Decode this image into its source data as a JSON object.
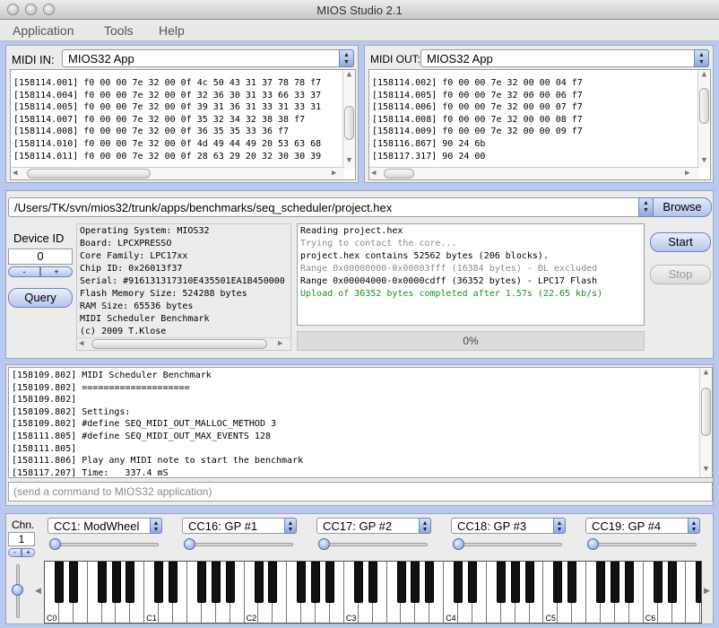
{
  "window": {
    "title": "MIOS Studio 2.1"
  },
  "menu": [
    "Application",
    "Tools",
    "Help"
  ],
  "midi_in": {
    "label": "MIDI IN:",
    "selected": "MIOS32 App",
    "lines": [
      "[158114.001] f0 00 00 7e 32 00 0f 4c 50 43 31 37 78 78 f7",
      "[158114.004] f0 00 00 7e 32 00 0f 32 36 30 31 33 66 33 37",
      "[158114.005] f0 00 00 7e 32 00 0f 39 31 36 31 33 31 33 31",
      "[158114.007] f0 00 00 7e 32 00 0f 35 32 34 32 38 38 f7",
      "[158114.008] f0 00 00 7e 32 00 0f 36 35 35 33 36 f7",
      "[158114.010] f0 00 00 7e 32 00 0f 4d 49 44 49 20 53 63 68",
      "[158114.011] f0 00 00 7e 32 00 0f 28 63 29 20 32 30 30 39"
    ]
  },
  "midi_out": {
    "label": "MIDI OUT:",
    "selected": "MIOS32 App",
    "lines": [
      "[158114.002] f0 00 00 7e 32 00 00 04 f7",
      "[158114.005] f0 00 00 7e 32 00 00 06 f7",
      "[158114.006] f0 00 00 7e 32 00 00 07 f7",
      "[158114.008] f0 00 00 7e 32 00 00 08 f7",
      "[158114.009] f0 00 00 7e 32 00 00 09 f7",
      "[158116.867] 90 24 6b",
      "[158117.317] 90 24 00"
    ]
  },
  "upload": {
    "file_path": "/Users/TK/svn/mios32/trunk/apps/benchmarks/seq_scheduler/project.hex",
    "browse_label": "Browse",
    "device_id_label": "Device ID",
    "device_id_value": "0",
    "dec_label": "-",
    "inc_label": "+",
    "query_label": "Query",
    "start_label": "Start",
    "stop_label": "Stop",
    "progress_text": "0%",
    "progress": 0,
    "info_lines": [
      "Operating System: MIOS32",
      "Board: LPCXPRESSO",
      "Core Family: LPC17xx",
      "Chip ID: 0x26013f37",
      "Serial: #916131317310E435501EA1B450000",
      "Flash Memory Size: 524288 bytes",
      "RAM Size: 65536 bytes",
      "MIDI Scheduler Benchmark",
      "(c) 2009 T.Klose"
    ],
    "status_lines": [
      {
        "text": "Reading project.hex",
        "color": "#000000"
      },
      {
        "text": "Trying to contact the core...",
        "color": "#8a8a8a"
      },
      {
        "text": "project.hex contains 52562 bytes (206 blocks).",
        "color": "#000000"
      },
      {
        "text": "Range 0x00000000-0x00003fff (16384 bytes) - BL excluded",
        "color": "#8a8a8a"
      },
      {
        "text": "Range 0x00004000-0x0000cdff (36352 bytes) - LPC17 Flash",
        "color": "#000000"
      },
      {
        "text": "Upload of 36352 bytes completed after 1.57s (22.65 kb/s)",
        "color": "#1e8e1e"
      }
    ]
  },
  "terminal": {
    "lines": [
      "[158109.802] MIDI Scheduler Benchmark",
      "[158109.802] ====================",
      "[158109.802]",
      "[158109.802] Settings:",
      "[158109.802] #define SEQ_MIDI_OUT_MALLOC_METHOD 3",
      "[158111.805] #define SEQ_MIDI_OUT_MAX_EVENTS 128",
      "[158111.805]",
      "[158111.806] Play any MIDI note to start the benchmark",
      "[158117.207] Time:   337.4 mS"
    ],
    "command_placeholder": "(send a command to MIOS32 application)"
  },
  "keyboard_panel": {
    "channel_label": "Chn.",
    "channel_value": "1",
    "dec_label": "-",
    "inc_label": "+",
    "cc_controls": [
      {
        "label": "CC1: ModWheel",
        "value": 0
      },
      {
        "label": "CC16: GP #1",
        "value": 0
      },
      {
        "label": "CC17: GP #2",
        "value": 0
      },
      {
        "label": "CC18: GP #3",
        "value": 0
      },
      {
        "label": "CC19: GP #4",
        "value": 0
      }
    ],
    "octave_labels": [
      "C0",
      "C1",
      "C2",
      "C3",
      "C4",
      "C5",
      "C6"
    ]
  }
}
